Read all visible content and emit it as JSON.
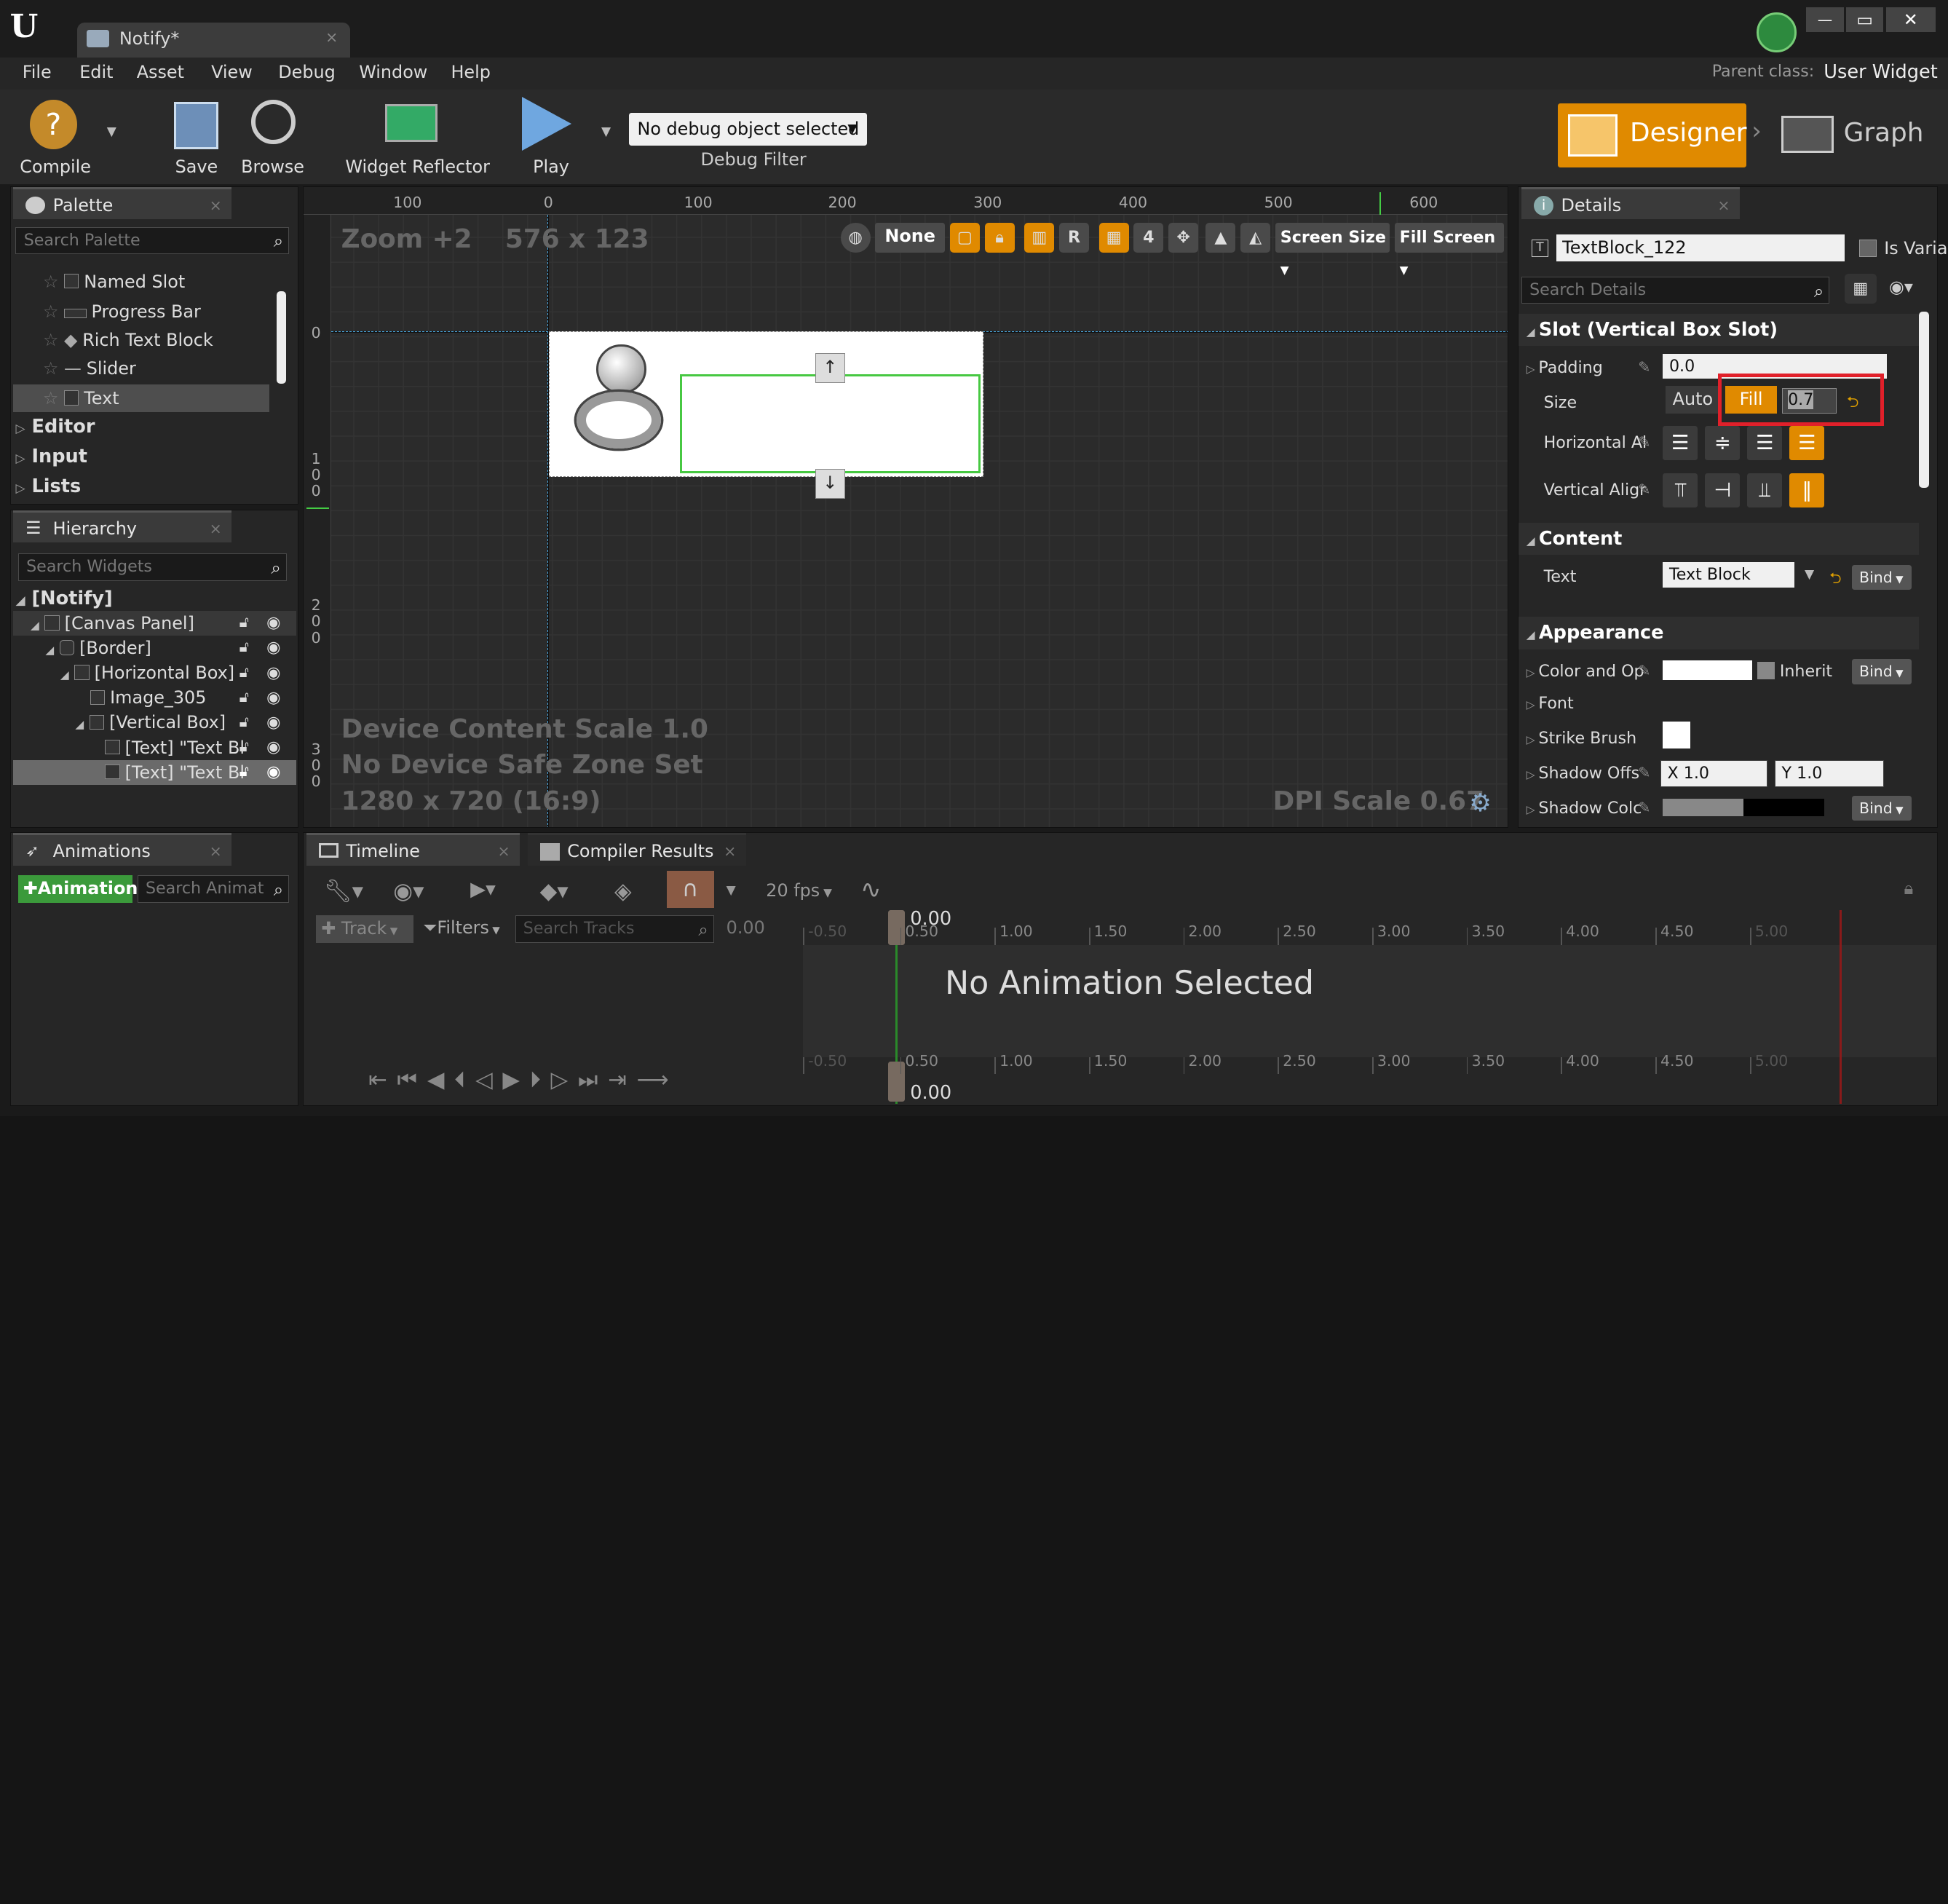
{
  "window": {
    "tab_title": "Notify*",
    "minimize": "—",
    "maximize": "▭",
    "close": "✕"
  },
  "menu": [
    "File",
    "Edit",
    "Asset",
    "View",
    "Debug",
    "Window",
    "Help"
  ],
  "parent_class": {
    "label": "Parent class:",
    "value": "User Widget"
  },
  "toolbar": {
    "compile": "Compile",
    "save": "Save",
    "browse": "Browse",
    "widget_reflector": "Widget Reflector",
    "play": "Play",
    "debug_select": "No debug object selected",
    "debug_filter": "Debug Filter"
  },
  "modes": {
    "designer": "Designer",
    "graph": "Graph"
  },
  "palette": {
    "tab": "Palette",
    "search_placeholder": "Search Palette",
    "items": [
      "Named Slot",
      "Progress Bar",
      "Rich Text Block",
      "Slider",
      "Text"
    ],
    "categories": [
      "Editor",
      "Input",
      "Lists"
    ]
  },
  "hierarchy": {
    "tab": "Hierarchy",
    "search_placeholder": "Search Widgets",
    "root": "[Notify]",
    "nodes": [
      "[Canvas Panel]",
      "[Border]",
      "[Horizontal Box]",
      "Image_305",
      "[Vertical Box]",
      "[Text] \"Text Bl",
      "[Text] \"Text Bl"
    ]
  },
  "viewport": {
    "zoom": "Zoom +2",
    "size": "576 x 123",
    "ruler_top": [
      "100",
      "0",
      "100",
      "200",
      "300",
      "400",
      "500",
      "600"
    ],
    "ruler_left": [
      "0",
      "100",
      "200",
      "300"
    ],
    "toolbar": {
      "none": "None",
      "r": "R",
      "grid": "4",
      "screen_size": "Screen Size",
      "fill_screen": "Fill Screen"
    },
    "device_scale": "Device Content Scale 1.0",
    "safe_zone": "No Device Safe Zone Set",
    "resolution": "1280 x 720 (16:9)",
    "dpi": "DPI Scale 0.67"
  },
  "details": {
    "tab": "Details",
    "widget_name": "TextBlock_122",
    "is_variable": "Is Varia",
    "search_placeholder": "Search Details",
    "slot_section": "Slot (Vertical Box Slot)",
    "padding_label": "Padding",
    "padding_value": "0.0",
    "size_label": "Size",
    "size_auto": "Auto",
    "size_fill": "Fill",
    "size_value": "0.7",
    "halign_label": "Horizontal Al",
    "valign_label": "Vertical Aligr",
    "content_section": "Content",
    "text_label": "Text",
    "text_value": "Text Block",
    "bind": "Bind",
    "appearance_section": "Appearance",
    "color_label": "Color and Op",
    "inherit": "Inherit",
    "font_label": "Font",
    "strike_label": "Strike Brush",
    "shadow_offset_label": "Shadow Offs",
    "shadow_x": "X  1.0",
    "shadow_y": "Y  1.0",
    "shadow_color_label": "Shadow Colc"
  },
  "animations": {
    "tab": "Animations",
    "add_button": "Animation",
    "search_placeholder": "Search Animat"
  },
  "timeline": {
    "tab": "Timeline",
    "compiler_tab": "Compiler Results",
    "fps": "20 fps",
    "track_button": "Track",
    "filters": "Filters",
    "search_placeholder": "Search Tracks",
    "time_value": "0.00",
    "playhead": "0.00",
    "playhead_bottom": "0.00",
    "ticks": [
      "-0.50",
      "0.50",
      "1.00",
      "1.50",
      "2.00",
      "2.50",
      "3.00",
      "3.50",
      "4.00",
      "4.50",
      "5.00"
    ],
    "empty_message": "No Animation Selected"
  },
  "colors": {
    "accent": "#e08a00",
    "selection": "#47c842",
    "highlight_box": "#e0202a"
  }
}
